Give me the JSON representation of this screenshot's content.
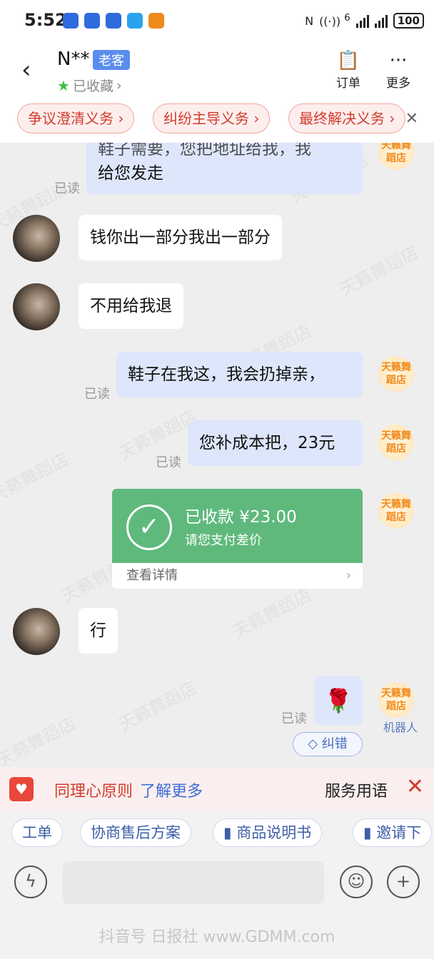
{
  "status_bar": {
    "time": "5:52",
    "battery": "100",
    "network_label": "6"
  },
  "header": {
    "contact_name": "N**",
    "tag": "老客",
    "favorite_label": "已收藏",
    "order_label": "订单",
    "more_label": "更多"
  },
  "obligations": [
    "争议澄清义务",
    "纠纷主导义务",
    "最终解决义务"
  ],
  "watermark_text": "天籁舞蹈店",
  "messages": {
    "m1_text": "给您发走",
    "m1_cut": "鞋子需要，您把地址给我，我",
    "m2_text": "钱你出一部分我出一部分",
    "m3_text": "不用给我退",
    "m4_text": "鞋子在我这，我会扔掉亲，",
    "m5_text": "您补成本把，23元",
    "m6_text": "行",
    "read_label": "已读",
    "shop_badge": "天籁舞蹈店",
    "robot_label": "机器人",
    "rose": "🌹",
    "fix_label": "纠错"
  },
  "payment": {
    "title": "已收款 ¥23.00",
    "subtitle": "请您支付差价",
    "details_label": "查看详情",
    "accent_color": "#5fb97c"
  },
  "empathy": {
    "title": "同理心原则",
    "more": "了解更多",
    "service": "服务用语"
  },
  "quick_actions": [
    "工单",
    "协商售后方案",
    "商品说明书",
    "邀请下"
  ],
  "footer": {
    "watermark": "抖音号 日报社 www.GDMM.com"
  }
}
